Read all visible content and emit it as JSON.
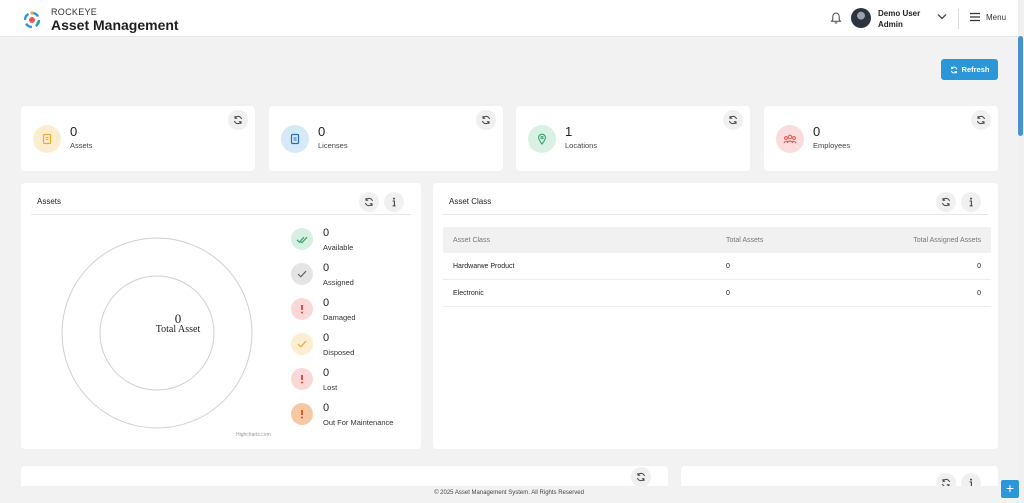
{
  "header": {
    "brand_top": "ROCKEYE",
    "brand_title": "Asset Management",
    "user_name": "Demo User",
    "user_role": "Admin",
    "menu_label": "Menu"
  },
  "toolbar": {
    "refresh_label": "Refresh"
  },
  "stats": [
    {
      "value": "0",
      "label": "Assets",
      "icon": "clipboard-icon",
      "color": "#f3a929"
    },
    {
      "value": "0",
      "label": "Licenses",
      "icon": "license-icon",
      "color": "#2a6fb3"
    },
    {
      "value": "1",
      "label": "Locations",
      "icon": "location-pin-icon",
      "color": "#3aa36f"
    },
    {
      "value": "0",
      "label": "Employees",
      "icon": "people-icon",
      "color": "#e25555"
    }
  ],
  "assets_panel": {
    "title": "Assets",
    "total_value": "0",
    "total_label": "Total Asset",
    "credits": "Highcharts.com",
    "statuses": [
      {
        "value": "0",
        "label": "Available",
        "icon": "double-check-icon"
      },
      {
        "value": "0",
        "label": "Assigned",
        "icon": "check-icon"
      },
      {
        "value": "0",
        "label": "Damaged",
        "icon": "exclamation-icon"
      },
      {
        "value": "0",
        "label": "Disposed",
        "icon": "check-icon"
      },
      {
        "value": "0",
        "label": "Lost",
        "icon": "exclamation-icon"
      },
      {
        "value": "0",
        "label": "Out For Maintenance",
        "icon": "exclamation-icon"
      }
    ]
  },
  "asset_class_panel": {
    "title": "Asset Class",
    "columns": [
      "Asset Class",
      "Total Assets",
      "Total Assigned Assets"
    ],
    "rows": [
      [
        "Hardwarwe Product",
        "0",
        "0"
      ],
      [
        "Electronic",
        "0",
        "0"
      ]
    ]
  },
  "footer": {
    "text": "© 2025 Asset Management System. All Rights Reserved"
  },
  "colors": {
    "accent": "#2b97d8"
  }
}
